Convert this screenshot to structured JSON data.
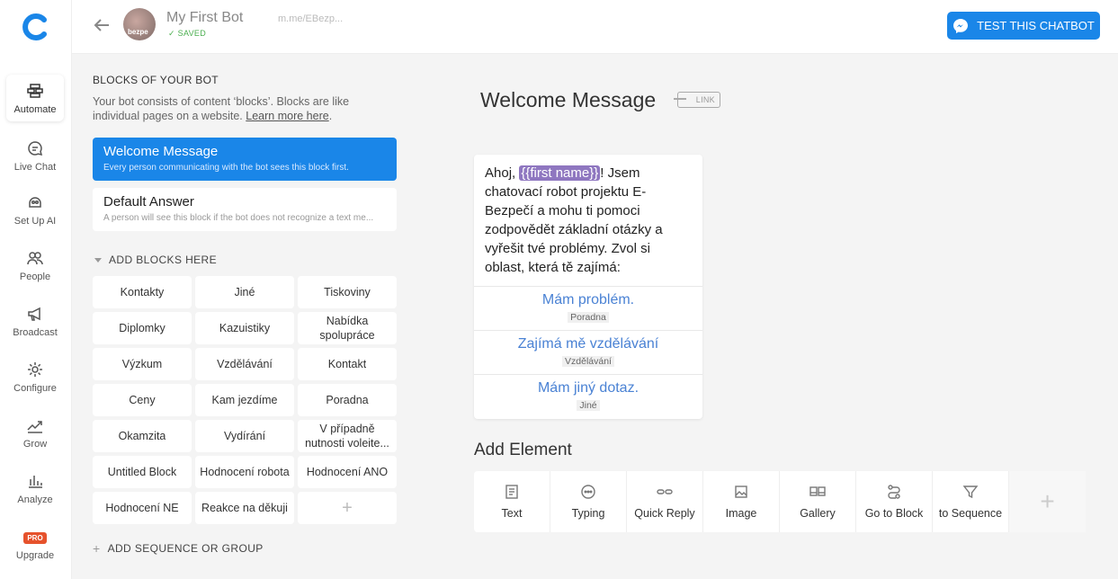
{
  "nav": {
    "items": [
      {
        "label": "Automate",
        "icon": "blocks-icon"
      },
      {
        "label": "Live Chat",
        "icon": "chat-icon"
      },
      {
        "label": "Set Up AI",
        "icon": "ai-icon"
      },
      {
        "label": "People",
        "icon": "people-icon"
      },
      {
        "label": "Broadcast",
        "icon": "megaphone-icon"
      },
      {
        "label": "Configure",
        "icon": "gear-icon"
      },
      {
        "label": "Grow",
        "icon": "trend-icon"
      },
      {
        "label": "Analyze",
        "icon": "bar-chart-icon"
      },
      {
        "label": "Upgrade",
        "badge": "PRO"
      }
    ]
  },
  "header": {
    "bot_name": "My First Bot",
    "status": "SAVED",
    "link": "m.me/EBezp...",
    "avatar_text": "bezpe",
    "test_button": "TEST THIS CHATBOT"
  },
  "blocks_panel": {
    "heading": "BLOCKS OF YOUR BOT",
    "desc": "Your bot consists of content ‘blocks’. Blocks are like individual pages on a website. ",
    "learn_more": "Learn more here",
    "desc_end": ".",
    "welcome": {
      "title": "Welcome Message",
      "sub": "Every person communicating with the bot sees this block first."
    },
    "default": {
      "title": "Default Answer",
      "sub": "A person will see this block if the bot does not recognize a text me..."
    },
    "add_blocks_label": "ADD BLOCKS HERE",
    "grid": [
      "Kontakty",
      "Jiné",
      "Tiskoviny",
      "Diplomky",
      "Kazuistiky",
      "Nabídka spolupráce",
      "Výzkum",
      "Vzdělávání",
      "Kontakt",
      "Ceny",
      "Kam jezdíme",
      "Poradna",
      "Okamzita",
      "Vydírání",
      "V případně nutnosti voleite...",
      "Untitled Block",
      "Hodnocení robota",
      "Hodnocení ANO",
      "Hodnocení NE",
      "Reakce na děkuji"
    ],
    "add_block_plus": "+",
    "add_sequence_label": "ADD SEQUENCE OR GROUP"
  },
  "editor": {
    "block_title": "Welcome Message",
    "link_label": "LINK",
    "message": {
      "pre": "Ahoj, ",
      "var": "{{first name}}",
      "post": "! Jsem chatovací robot projektu E-Bezpečí a mohu ti pomoci zodpovědět základní otázky a vyřešit tvé problémy. Zvol si oblast, která tě zajímá:"
    },
    "quick_replies": [
      {
        "title": "Mám problém.",
        "target": "Poradna"
      },
      {
        "title": "Zajímá mě vzdělávání",
        "target": "Vzdělávání"
      },
      {
        "title": "Mám jiný dotaz.",
        "target": "Jiné"
      }
    ],
    "add_element_title": "Add Element",
    "elements": [
      "Text",
      "Typing",
      "Quick Reply",
      "Image",
      "Gallery",
      "Go to Block",
      "to Sequence"
    ],
    "add_element_plus": "+"
  },
  "colors": {
    "accent": "#1a86e8",
    "variable": "#8f77c0",
    "quick_reply": "#4a82d4",
    "saved": "#4caf50",
    "pro": "#e6522c"
  }
}
